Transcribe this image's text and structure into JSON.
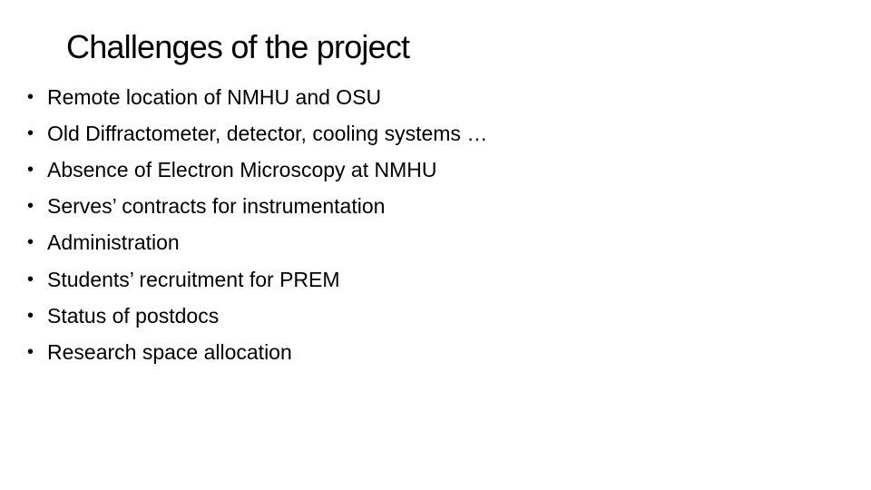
{
  "slide": {
    "title": "Challenges of the project",
    "bullet_symbol": "•",
    "bullets": [
      "Remote location of NMHU and OSU",
      "Old Diffractometer, detector, cooling systems …",
      "Absence of Electron Microscopy at NMHU",
      "Serves’ contracts for instrumentation",
      "Administration",
      "Students’ recruitment for PREM",
      "Status of postdocs",
      "Research space allocation"
    ]
  }
}
